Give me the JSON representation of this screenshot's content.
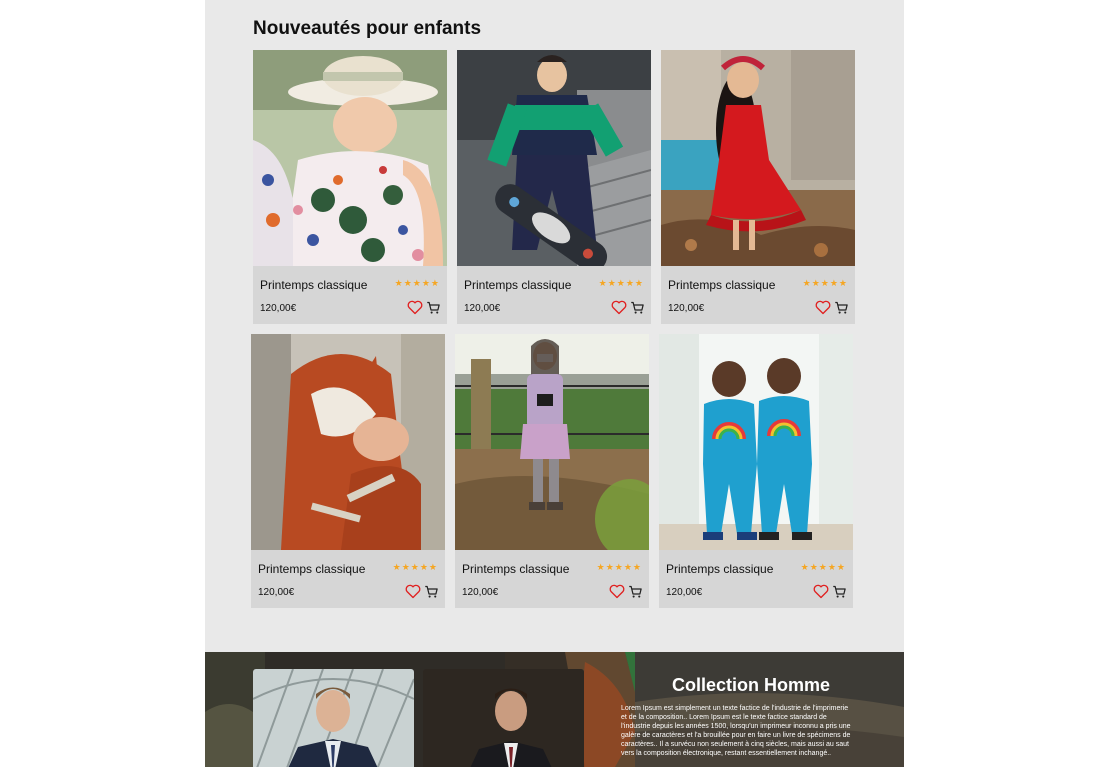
{
  "section": {
    "title": "Nouveautés pour enfants"
  },
  "products": [
    {
      "name": "Printemps classique",
      "price": "120,00€",
      "rating": 5,
      "stars": "★★★★★",
      "photo": "child-floral-dress-hat"
    },
    {
      "name": "Printemps classique",
      "price": "120,00€",
      "rating": 5,
      "stars": "★★★★★",
      "photo": "child-skateboard-stairs"
    },
    {
      "name": "Printemps classique",
      "price": "120,00€",
      "rating": 5,
      "stars": "★★★★★",
      "photo": "girl-red-dress"
    },
    {
      "name": "Printemps classique",
      "price": "120,00€",
      "rating": 5,
      "stars": "★★★★★",
      "photo": "child-fox-hood-jacket"
    },
    {
      "name": "Printemps classique",
      "price": "120,00€",
      "rating": 5,
      "stars": "★★★★★",
      "photo": "girl-camera-mask"
    },
    {
      "name": "Printemps classique",
      "price": "120,00€",
      "rating": 5,
      "stars": "★★★★★",
      "photo": "twins-blue-rainbow"
    }
  ],
  "icons": {
    "favorite": "heart-icon",
    "cart": "cart-icon",
    "rating": "star-icon"
  },
  "colors": {
    "star": "#f5a623",
    "heart": "#e02020",
    "panel": "#e9e9e9",
    "card": "#d6d6d6"
  },
  "banner": {
    "title": "Collection Homme",
    "description": "Lorem Ipsum est simplement un texte factice de l'industrie de l'imprimerie et de la composition.. Lorem Ipsum est le texte factice standard de l'industrie depuis les années 1500, lorsqu'un imprimeur inconnu a pris une galère de caractères et l'a brouillée pour en faire un livre de spécimens de caractères.. Il a survécu non seulement à cinq siècles, mais aussi au saut vers la composition électronique, restant essentiellement inchangé.."
  }
}
